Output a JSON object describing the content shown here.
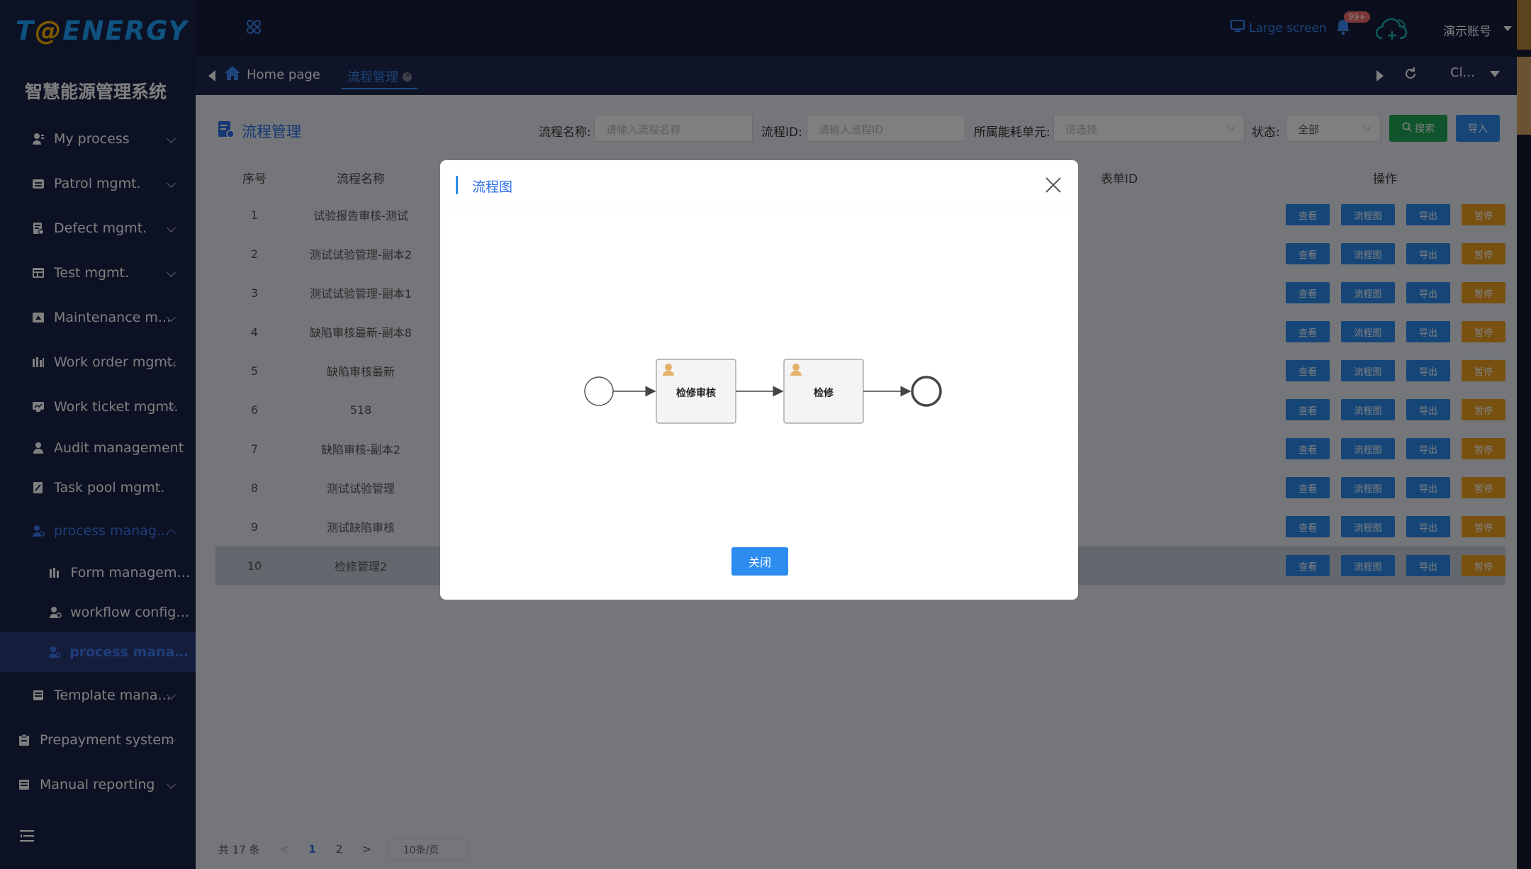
{
  "brand": {
    "logo_pre": "T",
    "logo_o": "@",
    "logo_post": "ENERGY",
    "system_title": "智慧能源管理系统"
  },
  "sidebar": {
    "items": [
      {
        "label": "My process"
      },
      {
        "label": "Patrol mgmt."
      },
      {
        "label": "Defect mgmt."
      },
      {
        "label": "Test mgmt."
      },
      {
        "label": "Maintenance m..."
      },
      {
        "label": "Work order mgmt."
      },
      {
        "label": "Work ticket mgmt."
      },
      {
        "label": "Audit management"
      },
      {
        "label": "Task pool mgmt."
      },
      {
        "label": "process manag..."
      },
      {
        "label": "Form management"
      },
      {
        "label": "workflow configur..."
      },
      {
        "label": "process manage..."
      },
      {
        "label": "Template mana..."
      },
      {
        "label": "Prepayment system"
      },
      {
        "label": "Manual reporting"
      }
    ]
  },
  "topbar": {
    "large_screen": "Large screen",
    "badge": "99+",
    "user": "演示账号"
  },
  "tabs": {
    "home": "Home page",
    "current": "流程管理",
    "close_label": "Cl..."
  },
  "page": {
    "title": "流程管理",
    "filters": {
      "name_label": "流程名称:",
      "name_placeholder": "请输入流程名称",
      "id_label": "流程ID:",
      "id_placeholder": "请输入流程ID",
      "unit_label": "所属能耗单元:",
      "unit_placeholder": "请选择",
      "status_label": "状态:",
      "status_value": "全部"
    },
    "search_label": "搜索",
    "import_label": "导入"
  },
  "table": {
    "headers": {
      "index": "序号",
      "name": "流程名称",
      "form_id": "表单ID",
      "ops": "操作"
    },
    "ops": {
      "view": "查看",
      "diagram": "流程图",
      "export": "导出",
      "pause": "暂停"
    },
    "rows": [
      {
        "index": "1",
        "name": "试验报告审核-测试"
      },
      {
        "index": "2",
        "name": "测试试验管理-副本2"
      },
      {
        "index": "3",
        "name": "测试试验管理-副本1"
      },
      {
        "index": "4",
        "name": "缺陷审核最新-副本8"
      },
      {
        "index": "5",
        "name": "缺陷审核最新"
      },
      {
        "index": "6",
        "name": "518"
      },
      {
        "index": "7",
        "name": "缺陷审核-副本2"
      },
      {
        "index": "8",
        "name": "测试试验管理"
      },
      {
        "index": "9",
        "name": "测试缺陷审核"
      },
      {
        "index": "10",
        "name": "检修管理2"
      }
    ]
  },
  "pagination": {
    "total": "共 17 条",
    "pages": [
      "1",
      "2"
    ],
    "current": "1",
    "page_size": "10条/页"
  },
  "modal": {
    "title": "流程图",
    "task1": "检修审核",
    "task2": "检修",
    "close_button": "关闭"
  },
  "colors": {
    "accent": "#2d8cf0",
    "sidebar": "#1a2248",
    "success": "#1fa855",
    "warning": "#f0a020"
  }
}
